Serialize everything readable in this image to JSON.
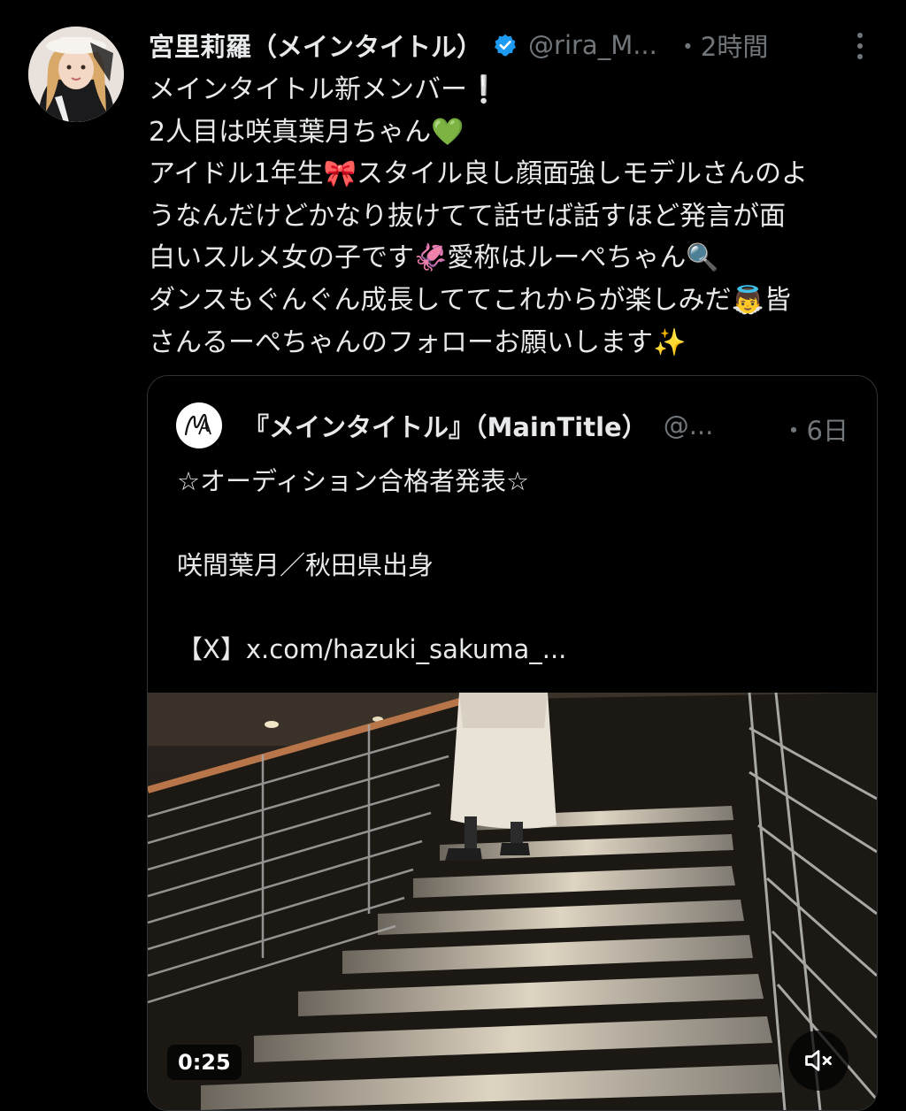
{
  "tweet": {
    "author_name": "宮里莉羅（メインタイトル）",
    "handle": "@rira_M...",
    "time": "・2時間",
    "lines": [
      "メインタイトル新メンバー❕",
      "2人目は咲真葉月ちゃん💚",
      "アイドル1年生🎀スタイル良し顔面強しモデルさんのよ",
      "うなんだけどかなり抜けてて話せば話すほど発言が面",
      "白いスルメ女の子です🦑愛称はルーぺちゃん🔍",
      "ダンスもぐんぐん成長しててこれからが楽しみだ👼皆",
      "さんるーぺちゃんのフォローお願いします✨"
    ]
  },
  "quoted_tweet": {
    "author_name": "『メインタイトル』（MainTitle）",
    "handle": "@...",
    "time": "・6日",
    "avatar_text": "M",
    "lines": [
      "☆オーディション合格者発表☆",
      "",
      "咲間葉月／秋田県出身",
      "",
      "【X】x.com/hazuki_sakuma_..."
    ]
  },
  "video": {
    "duration": "0:25"
  },
  "icons": {
    "verified": "verified-badge-icon",
    "more": "more-options-icon",
    "mute": "muted-speaker-icon"
  },
  "colors": {
    "background": "#000000",
    "text": "#e7e9ea",
    "secondary_text": "#71767b",
    "verified_blue": "#1d9bf0",
    "border": "#2f3336"
  }
}
